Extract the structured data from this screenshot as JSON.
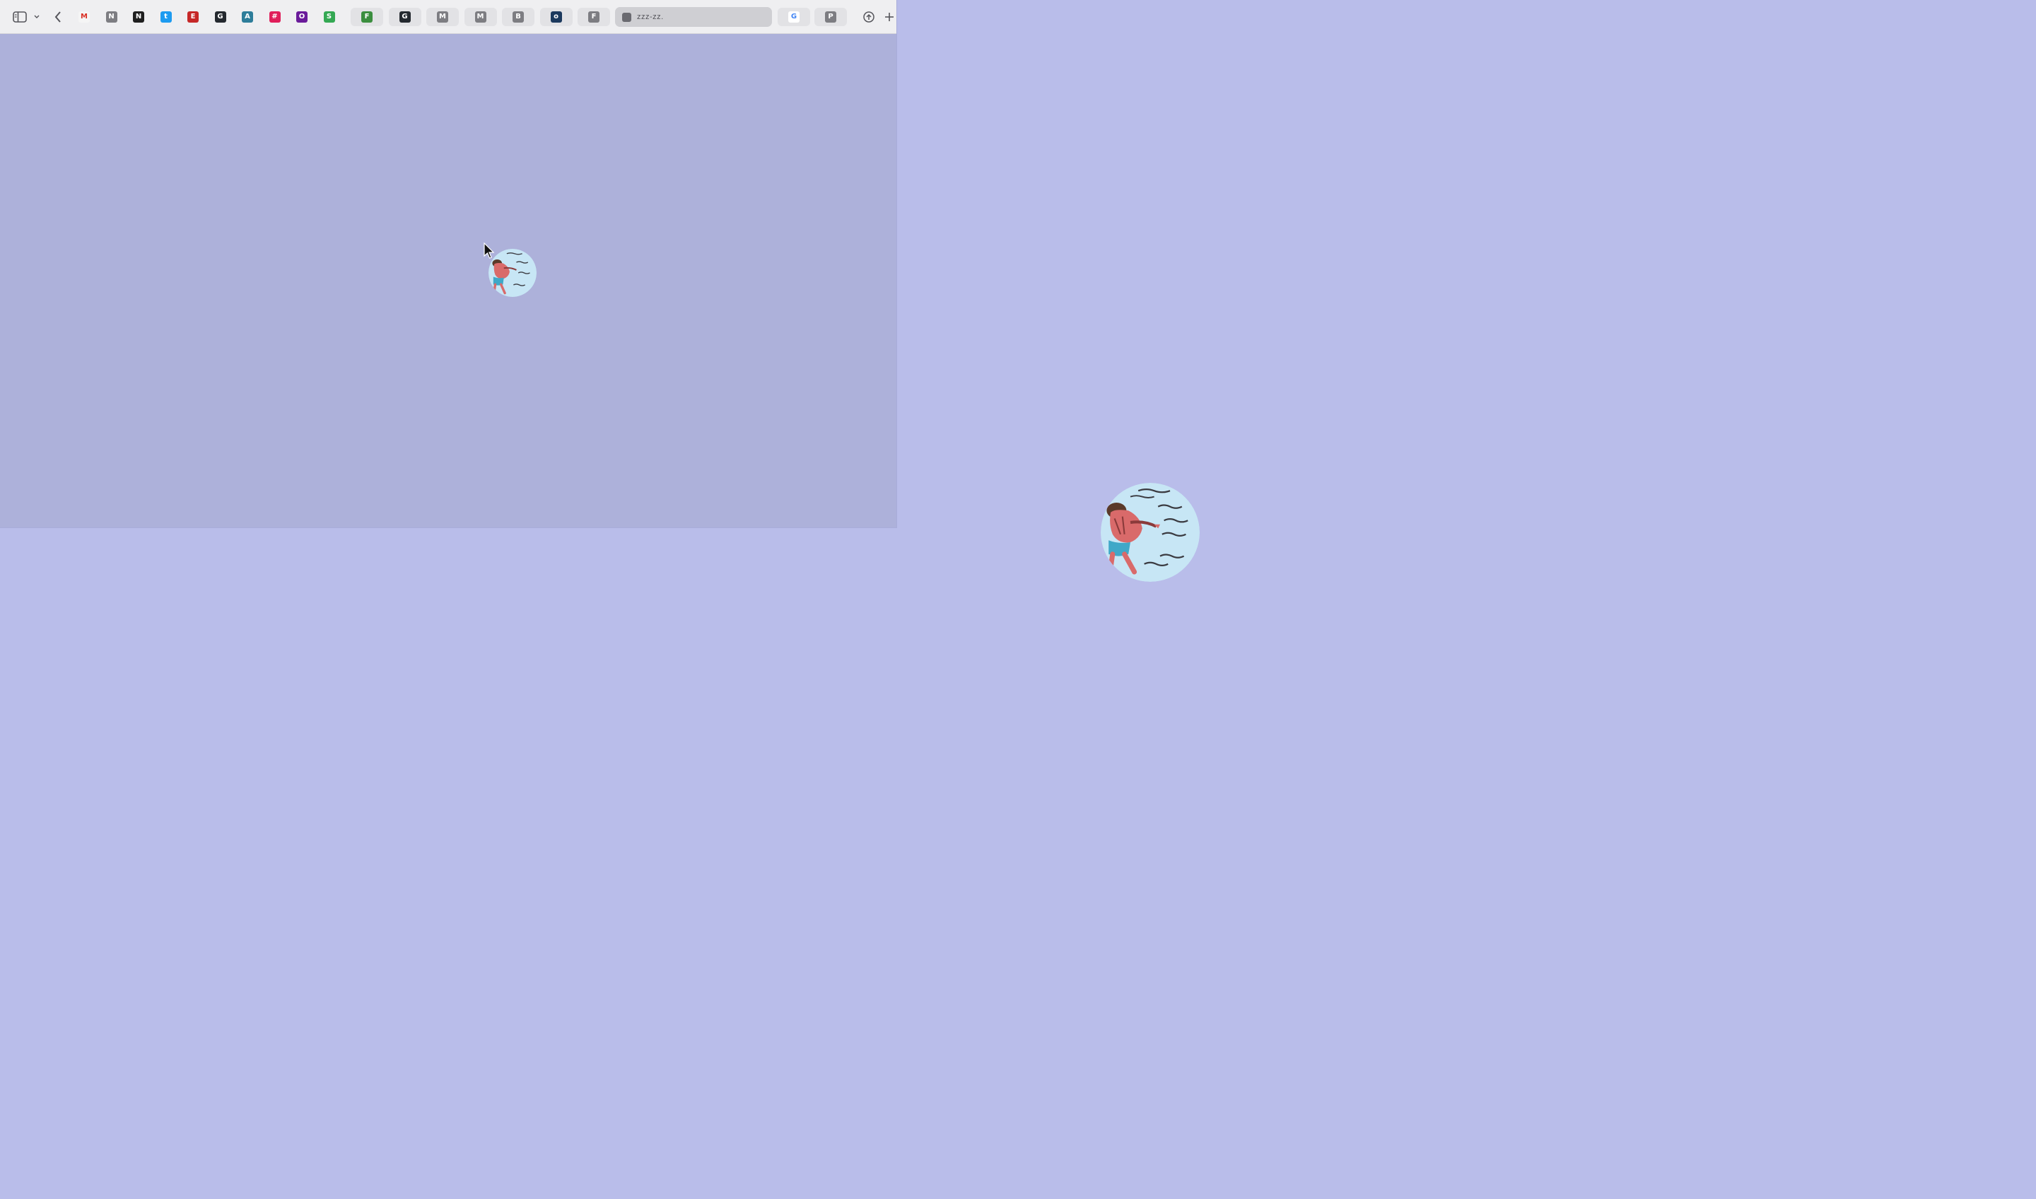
{
  "desktop": {
    "background_color": "#b9bdea"
  },
  "browser": {
    "content_background": "#adb1da",
    "toolbar": {
      "sidebar_toggle_icon": "sidebar-icon",
      "dropdown_icon": "chevron-down-icon",
      "back_icon": "chevron-left-icon",
      "address_bar_text": "zzz-zz.",
      "share_icon": "share-icon",
      "new_tab_icon": "plus-icon"
    },
    "pinned_tabs": [
      {
        "icon": "gmail-icon",
        "glyph": "M",
        "color": "#d93025",
        "bg": "#f5f5f5"
      },
      {
        "icon": "notion-icon",
        "glyph": "N",
        "color": "#ffffff",
        "bg": "#7d7d82"
      },
      {
        "icon": "notion-dark-icon",
        "glyph": "N",
        "color": "#ffffff",
        "bg": "#1f1f1f"
      },
      {
        "icon": "twitter-icon",
        "glyph": "t",
        "color": "#ffffff",
        "bg": "#1d9bf0"
      },
      {
        "icon": "red-app-icon",
        "glyph": "E",
        "color": "#ffffff",
        "bg": "#c62828"
      },
      {
        "icon": "github-icon",
        "glyph": "G",
        "color": "#ffffff",
        "bg": "#24292f"
      },
      {
        "icon": "chart-icon",
        "glyph": "A",
        "color": "#ffffff",
        "bg": "#2e7d9a"
      },
      {
        "icon": "slack-icon",
        "glyph": "#",
        "color": "#ffffff",
        "bg": "#e01e5a"
      },
      {
        "icon": "purple-app-icon",
        "glyph": "O",
        "color": "#ffffff",
        "bg": "#6a1b9a"
      },
      {
        "icon": "green-app-icon",
        "glyph": "S",
        "color": "#ffffff",
        "bg": "#34a853"
      }
    ],
    "tab_pills": [
      {
        "icon": "feather-icon",
        "glyph": "F",
        "color": "#ffffff",
        "bg": "#3b8e3f"
      },
      {
        "icon": "github-icon",
        "glyph": "G",
        "color": "#ffffff",
        "bg": "#24292f"
      },
      {
        "icon": "page-icon",
        "glyph": "M",
        "color": "#ffffff",
        "bg": "#7d7d82"
      },
      {
        "icon": "page-icon",
        "glyph": "M",
        "color": "#ffffff",
        "bg": "#7d7d82"
      },
      {
        "icon": "doc-icon",
        "glyph": "B",
        "color": "#ffffff",
        "bg": "#7d7d82"
      },
      {
        "icon": "globe-icon",
        "glyph": "o",
        "color": "#ffffff",
        "bg": "#1c3a5e"
      },
      {
        "icon": "page-icon",
        "glyph": "F",
        "color": "#ffffff",
        "bg": "#7d7d82"
      }
    ],
    "trailing_tabs": [
      {
        "icon": "google-icon",
        "glyph": "G",
        "color": "#4285f4",
        "bg": "#ffffff"
      },
      {
        "icon": "page-icon",
        "glyph": "P",
        "color": "#ffffff",
        "bg": "#7d7d82"
      }
    ]
  },
  "avatars": {
    "small_icon": "diver-avatar-icon",
    "large_icon": "diver-avatar-icon"
  },
  "cursor": {
    "icon": "mouse-pointer-icon"
  }
}
